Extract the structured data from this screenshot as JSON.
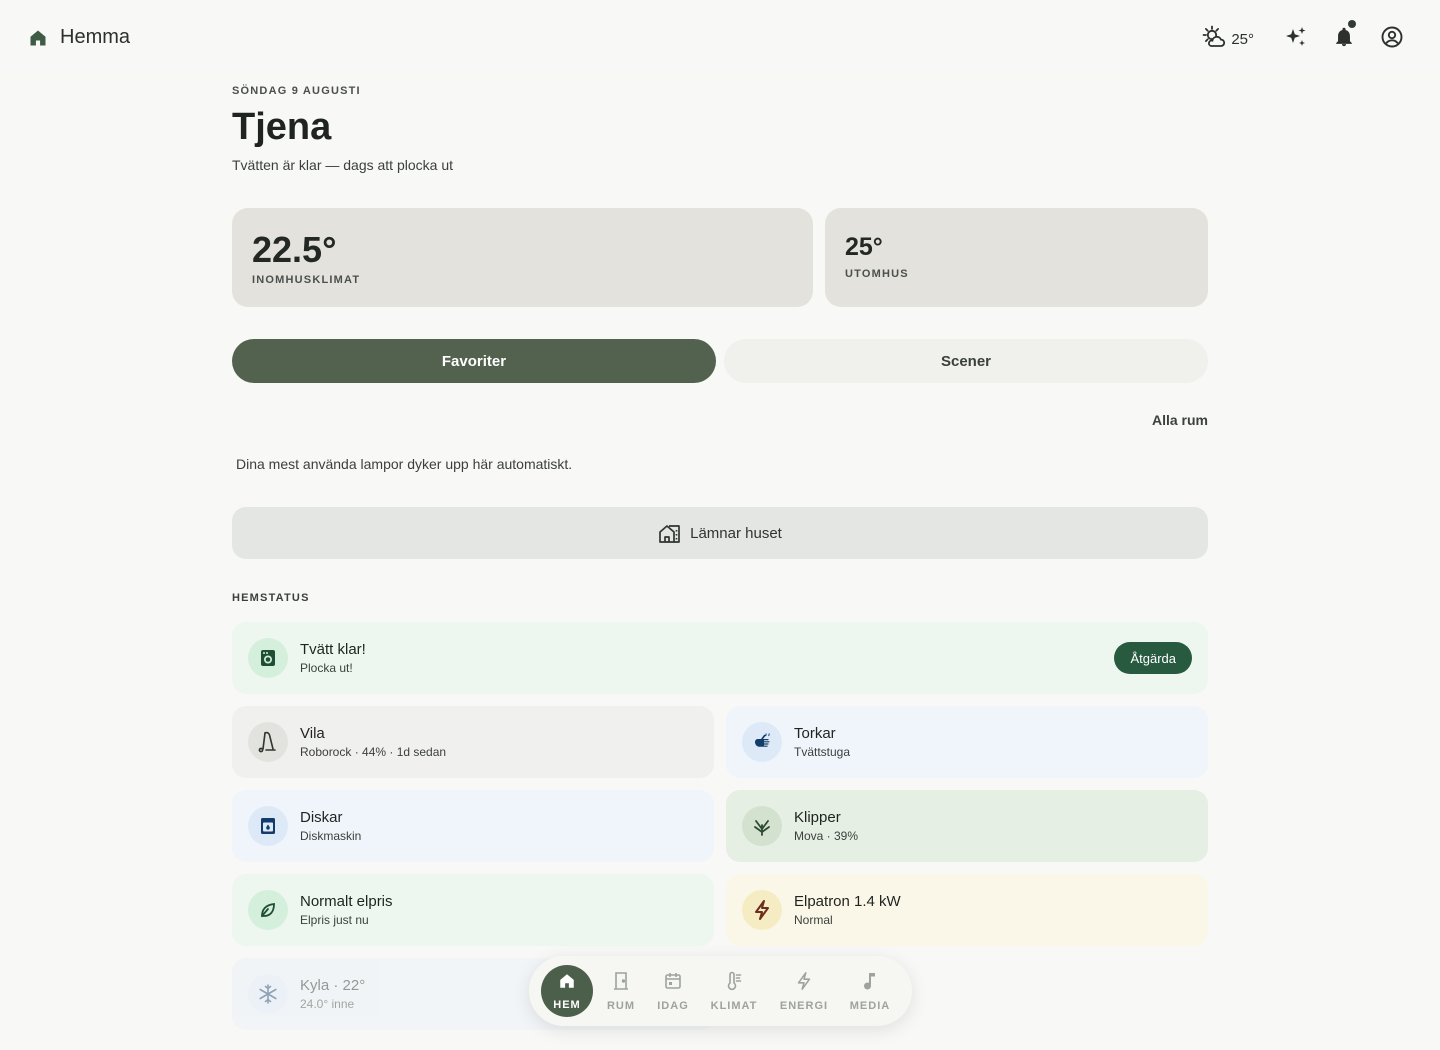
{
  "header": {
    "title": "Hemma",
    "weather_temp": "25°"
  },
  "main": {
    "date": "SÖNDAG 9 AUGUSTI",
    "greeting": "Tjena",
    "subline": "Tvätten är klar — dags att plocka ut",
    "climate": {
      "indoor_value": "22.5°",
      "indoor_label": "INOMHUSKLIMAT",
      "outdoor_value": "25°",
      "outdoor_label": "UTOMHUS"
    },
    "tabs": [
      {
        "label": "Favoriter",
        "active": true
      },
      {
        "label": "Scener",
        "active": false
      }
    ],
    "all_rooms": "Alla rum",
    "favorites_empty": "Dina mest använda lampor dyker upp här automatiskt.",
    "scene_button": "Lämnar huset",
    "section_label": "HEMSTATUS",
    "status": [
      {
        "title": "Tvätt klar!",
        "sub": "Plocka ut!",
        "action": "Åtgärda",
        "icon": "washing-machine-icon"
      },
      {
        "title": "Vila",
        "sub": "Roborock · 44% · 1d sedan",
        "icon": "robot-vacuum-icon"
      },
      {
        "title": "Torkar",
        "sub": "Tvättstuga",
        "icon": "tumble-dryer-icon"
      },
      {
        "title": "Diskar",
        "sub": "Diskmaskin",
        "icon": "dishwasher-icon"
      },
      {
        "title": "Klipper",
        "sub": "Mova · 39%",
        "icon": "lawn-mower-icon"
      },
      {
        "title": "Normalt elpris",
        "sub": "Elpris just nu",
        "icon": "leaf-icon"
      },
      {
        "title": "Elpatron 1.4 kW",
        "sub": "Normal",
        "icon": "lightning-icon"
      },
      {
        "title": "Kyla · 22°",
        "sub": "24.0° inne",
        "icon": "snowflake-icon"
      }
    ]
  },
  "nav": [
    {
      "label": "HEM",
      "icon": "home-icon",
      "active": true
    },
    {
      "label": "RUM",
      "icon": "door-icon"
    },
    {
      "label": "IDAG",
      "icon": "calendar-icon"
    },
    {
      "label": "KLIMAT",
      "icon": "thermometer-icon"
    },
    {
      "label": "ENERGI",
      "icon": "lightning-icon"
    },
    {
      "label": "MEDIA",
      "icon": "music-note-icon"
    }
  ],
  "colors": {
    "accent": "#52624f",
    "action": "#285a3f",
    "background": "#f8f8f6",
    "climate_card": "#e4e2dd"
  }
}
